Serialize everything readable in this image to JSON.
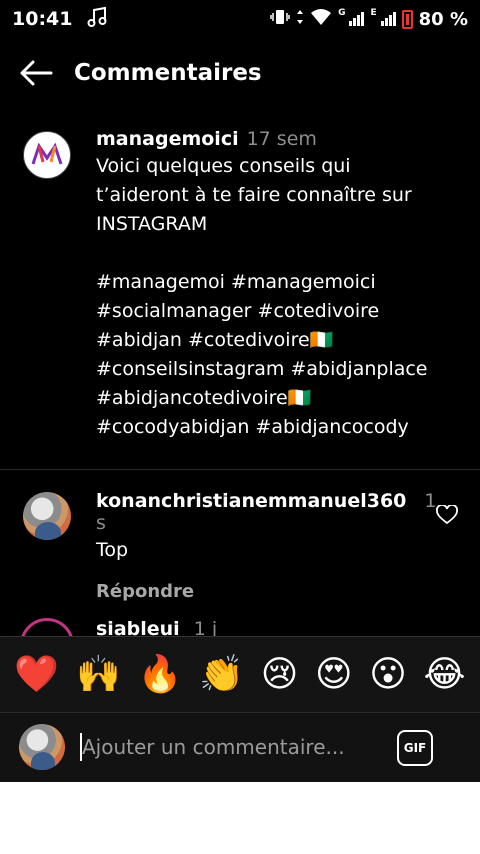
{
  "status_bar": {
    "time": "10:41",
    "network_g": "G",
    "network_e": "E",
    "battery": "80 %"
  },
  "header": {
    "title": "Commentaires"
  },
  "caption": {
    "username": "managemoici",
    "time": "17 sem",
    "text_lines": [
      "Voici quelques conseils qui",
      "t’aideront à te faire connaître sur",
      "INSTAGRAM"
    ],
    "hashtag_lines": [
      "#managemoi #managemoici",
      "#socialmanager #cotedivoire",
      "#abidjan #cotedivoire🇨🇮",
      "#conseilsinstagram #abidjanplace",
      "#abidjancotedivoire🇨🇮",
      "#cocodyabidjan #abidjancocody"
    ]
  },
  "comments": [
    {
      "username": "konanchristianemmanuel360",
      "time": "1 s",
      "text": "Top",
      "reply_label": "Répondre"
    },
    {
      "username": "siableui",
      "time": "1 j"
    }
  ],
  "emoji_bar": [
    "❤️",
    "🙌",
    "🔥",
    "👏",
    "😢",
    "😍",
    "😮",
    "😂"
  ],
  "input": {
    "placeholder": "Ajouter un commentaire...",
    "gif_label": "GIF"
  },
  "colors": {
    "background": "#000000",
    "muted": "#8e8e8e",
    "accent": "#ffffff"
  }
}
